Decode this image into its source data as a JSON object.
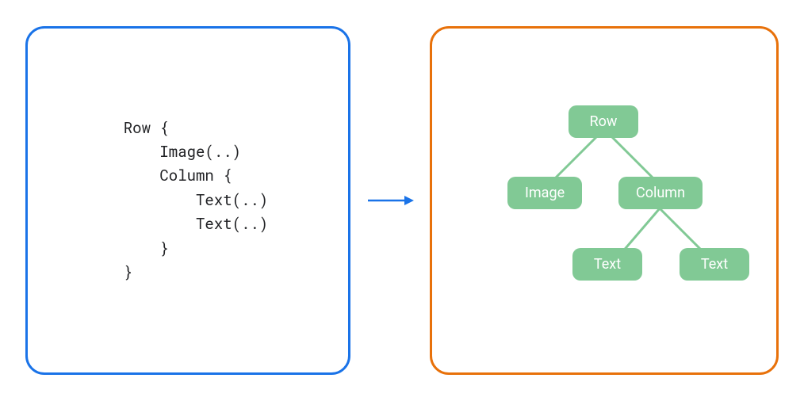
{
  "code": {
    "lines": [
      "Row {",
      "    Image(..)",
      "    Column {",
      "        Text(..)",
      "        Text(..)",
      "    }",
      "}"
    ]
  },
  "tree": {
    "nodes": {
      "root": {
        "label": "Row"
      },
      "image": {
        "label": "Image"
      },
      "column": {
        "label": "Column"
      },
      "text1": {
        "label": "Text"
      },
      "text2": {
        "label": "Text"
      }
    }
  },
  "colors": {
    "code_panel_border": "#1a73e8",
    "tree_panel_border": "#e8710a",
    "arrow": "#1a73e8",
    "node_bg": "#81c995",
    "node_text": "#ffffff",
    "edge": "#81c995"
  }
}
